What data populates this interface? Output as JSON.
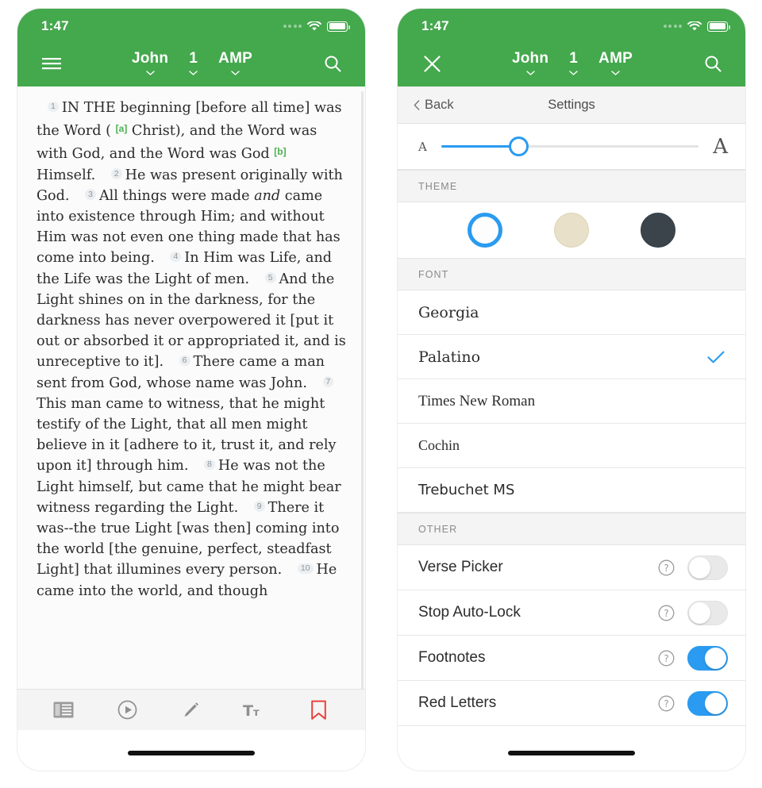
{
  "status_bar": {
    "time": "1:47",
    "wifi_icon": "wifi-icon",
    "battery_icon": "battery-full-icon",
    "signal_icon": "signal-dots-icon"
  },
  "reader": {
    "menu_icon": "hamburger-menu-icon",
    "search_icon": "search-icon",
    "book": "John",
    "chapter": "1",
    "version": "AMP",
    "chevron_icon": "chevron-down-icon",
    "verses": [
      {
        "num": "1",
        "parts": [
          {
            "t": "text",
            "v": "IN THE beginning [before all time] was the Word ( "
          },
          {
            "t": "footnote",
            "v": "[a]"
          },
          {
            "t": "text",
            "v": " Christ), and the Word was with God, and the Word was God "
          },
          {
            "t": "footnote",
            "v": "[b]"
          },
          {
            "t": "text",
            "v": " Himself."
          }
        ]
      },
      {
        "num": "2",
        "parts": [
          {
            "t": "text",
            "v": "He was present originally with God."
          }
        ]
      },
      {
        "num": "3",
        "parts": [
          {
            "t": "text",
            "v": "All things were made "
          },
          {
            "t": "italic",
            "v": "and"
          },
          {
            "t": "text",
            "v": " came into existence through Him; and without Him was not even one thing made that has come into being."
          }
        ]
      },
      {
        "num": "4",
        "parts": [
          {
            "t": "text",
            "v": "In Him was Life, and the Life was the Light of men."
          }
        ]
      },
      {
        "num": "5",
        "parts": [
          {
            "t": "text",
            "v": "And the Light shines on in the darkness, for the darkness has never overpowered it [put it out or absorbed it or appropriated it, and is unreceptive to it]."
          }
        ]
      },
      {
        "num": "6",
        "parts": [
          {
            "t": "text",
            "v": "There came a man sent from God, whose name was John."
          }
        ]
      },
      {
        "num": "7",
        "parts": [
          {
            "t": "text",
            "v": "This man came to witness, that he might testify of the Light, that all men might believe in it [adhere to it, trust it, and rely upon it] through him."
          }
        ]
      },
      {
        "num": "8",
        "parts": [
          {
            "t": "text",
            "v": "He was not the Light himself, but came that he might bear witness regarding the Light."
          }
        ]
      },
      {
        "num": "9",
        "parts": [
          {
            "t": "text",
            "v": "There it was--the true Light [was then] coming into the world [the genuine, perfect, steadfast Light] that illumines every person."
          }
        ]
      },
      {
        "num": "10",
        "parts": [
          {
            "t": "text",
            "v": "He came into the world, and though"
          }
        ]
      }
    ],
    "toolbar": [
      {
        "icon": "reader-view-icon",
        "active": false
      },
      {
        "icon": "audio-play-icon",
        "active": false
      },
      {
        "icon": "pencil-edit-icon",
        "active": false
      },
      {
        "icon": "text-size-icon",
        "active": false
      },
      {
        "icon": "bookmark-icon",
        "active": true
      }
    ]
  },
  "settings": {
    "close_icon": "close-x-icon",
    "search_icon": "search-icon",
    "book": "John",
    "chapter": "1",
    "version": "AMP",
    "chevron_icon": "chevron-down-icon",
    "back_label": "Back",
    "back_icon": "chevron-left-icon",
    "title": "Settings",
    "font_size": {
      "small_label": "A",
      "large_label": "A",
      "value_percent": 30
    },
    "theme": {
      "section_label": "THEME",
      "options": [
        {
          "name": "light-theme",
          "color": "#fdfdfd",
          "selected": true
        },
        {
          "name": "sepia-theme",
          "color": "#e8e0c8",
          "selected": false
        },
        {
          "name": "dark-theme",
          "color": "#3c444b",
          "selected": false
        }
      ]
    },
    "font": {
      "section_label": "FONT",
      "options": [
        {
          "label": "Georgia",
          "selected": false
        },
        {
          "label": "Palatino",
          "selected": true
        },
        {
          "label": "Times New Roman",
          "selected": false
        },
        {
          "label": "Cochin",
          "selected": false
        },
        {
          "label": "Trebuchet MS",
          "selected": false
        }
      ]
    },
    "other": {
      "section_label": "OTHER",
      "options": [
        {
          "label": "Verse Picker",
          "on": false,
          "help_icon": "help-circle-icon"
        },
        {
          "label": "Stop Auto-Lock",
          "on": false,
          "help_icon": "help-circle-icon"
        },
        {
          "label": "Footnotes",
          "on": true,
          "help_icon": "help-circle-icon"
        },
        {
          "label": "Red Letters",
          "on": true,
          "help_icon": "help-circle-icon"
        }
      ]
    }
  },
  "colors": {
    "brand_green": "#44a84d",
    "accent_blue": "#2a9bf0",
    "footnote_green": "#4caf50",
    "bookmark_red": "#e8413a"
  }
}
